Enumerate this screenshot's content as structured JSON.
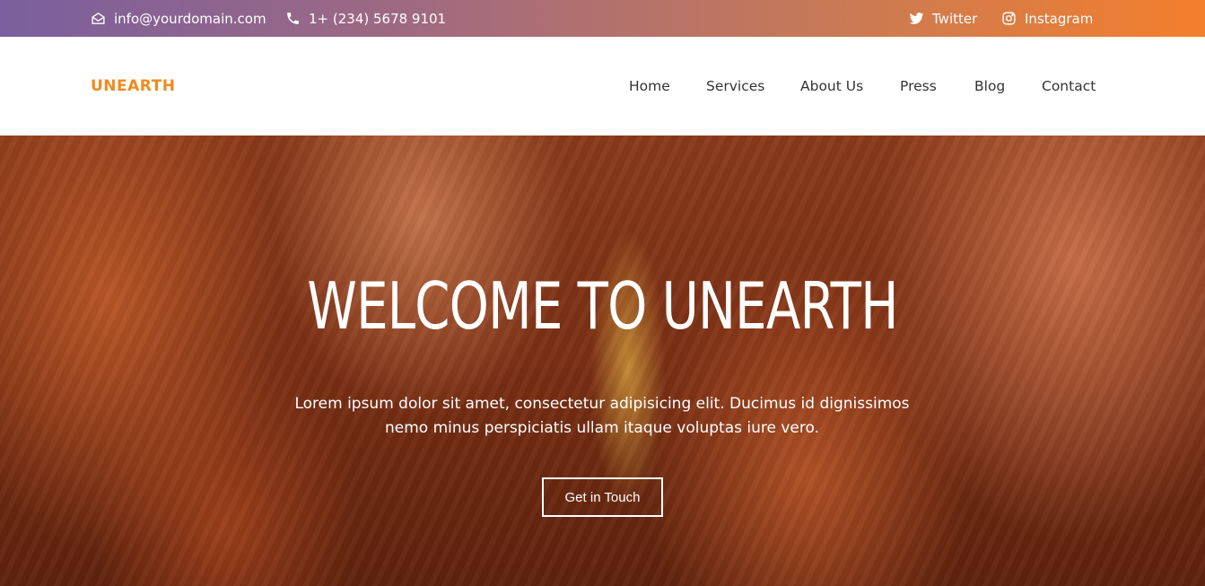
{
  "topbar": {
    "email": "info@yourdomain.com",
    "phone": "1+ (234) 5678 9101",
    "twitter": "Twitter",
    "instagram": "Instagram"
  },
  "nav": {
    "logo": "UNEARTH",
    "items": [
      "Home",
      "Services",
      "About Us",
      "Press",
      "Blog",
      "Contact"
    ]
  },
  "hero": {
    "title": "WELCOME TO UNEARTH",
    "subtitle": "Lorem ipsum dolor sit amet, consectetur adipisicing elit. Ducimus id dignissimos nemo minus perspiciatis ullam itaque voluptas iure vero.",
    "cta": "Get in Touch"
  },
  "colors": {
    "brand": "#f18a1f",
    "topbar_start": "#7a5f9e",
    "topbar_end": "#f47f2c"
  },
  "icons": {
    "email": "envelope-open-icon",
    "phone": "phone-icon",
    "twitter": "twitter-icon",
    "instagram": "instagram-icon"
  }
}
